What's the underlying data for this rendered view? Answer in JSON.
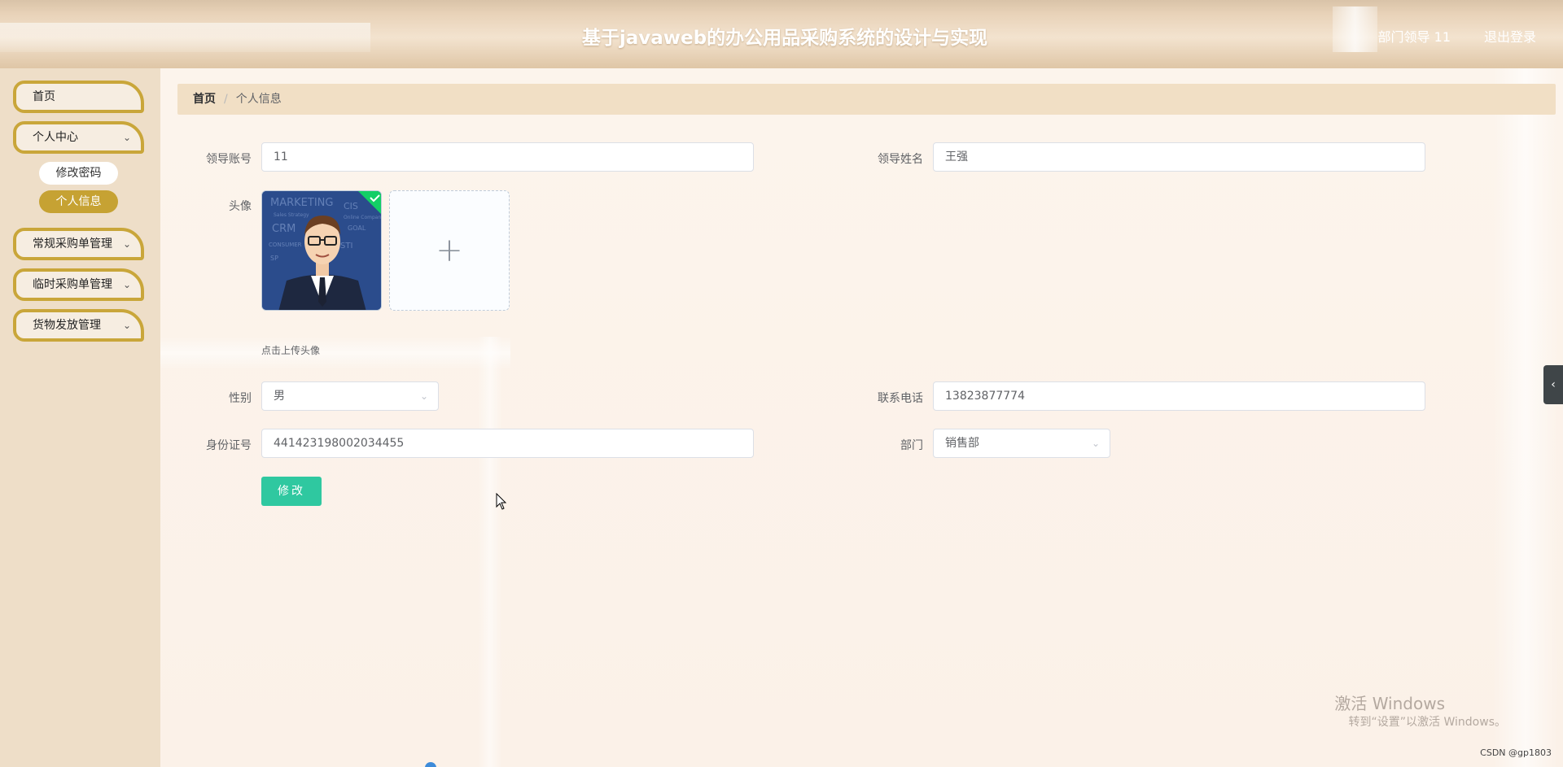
{
  "header": {
    "title": "基于javaweb的办公用品采购系统的设计与实现",
    "user": "部门领导 11",
    "logout": "退出登录"
  },
  "sidebar": {
    "items": [
      {
        "label": "首页"
      },
      {
        "label": "个人中心"
      },
      {
        "label": "常规采购单管理"
      },
      {
        "label": "临时采购单管理"
      },
      {
        "label": "货物发放管理"
      }
    ],
    "subitems": [
      {
        "label": "修改密码"
      },
      {
        "label": "个人信息"
      }
    ]
  },
  "breadcrumb": {
    "home": "首页",
    "separator": "/",
    "current": "个人信息"
  },
  "form": {
    "account": {
      "label": "领导账号",
      "value": "11"
    },
    "name": {
      "label": "领导姓名",
      "value": "王强"
    },
    "avatar": {
      "label": "头像",
      "tip": "点击上传头像",
      "add_icon": "+"
    },
    "gender": {
      "label": "性别",
      "value": "男"
    },
    "phone": {
      "label": "联系电话",
      "value": "13823877774"
    },
    "idcard": {
      "label": "身份证号",
      "value": "441423198002034455"
    },
    "department": {
      "label": "部门",
      "value": "销售部"
    },
    "submit_label": "修改"
  },
  "watermark": {
    "line1": "激活 Windows",
    "line2": "转到“设置”以激活 Windows。"
  },
  "footer": {
    "csdn": "CSDN @gp1803"
  },
  "side_tab": {
    "icon": "chevron-left-icon",
    "glyph": "‹"
  },
  "colors": {
    "accent_gold": "#c6a233",
    "button_teal": "#2fc8a0",
    "sidebar_bg": "#eedec8",
    "breadcrumb_bg": "#f1dfc5"
  }
}
